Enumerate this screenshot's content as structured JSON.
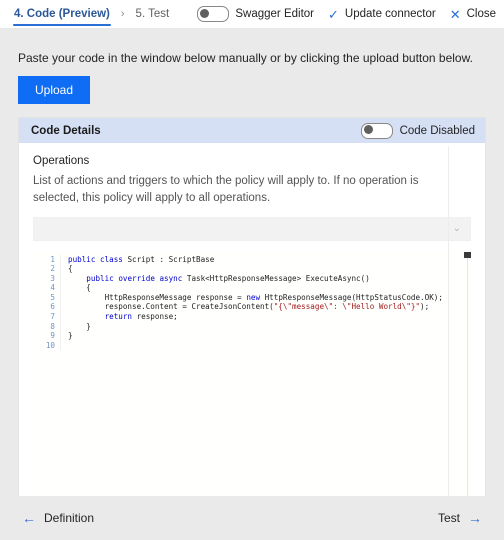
{
  "topbar": {
    "breadcrumbs": [
      {
        "label": "4. Code (Preview)",
        "active": true
      },
      {
        "label": "5. Test",
        "active": false
      }
    ],
    "separator": "›",
    "swagger_toggle_label": "Swagger Editor",
    "swagger_toggle_state": "off",
    "update_connector_label": "Update connector",
    "check_icon": "✓",
    "close_label": "Close",
    "close_icon": "✕"
  },
  "main": {
    "intro_text": "Paste your code in the window below manually or by clicking the upload button below.",
    "upload_label": "Upload"
  },
  "card": {
    "title": "Code Details",
    "code_toggle_label": "Code Disabled",
    "code_toggle_state": "off",
    "operations_label": "Operations",
    "operations_description": "List of actions and triggers to which the policy will apply to. If no operation is selected, this policy will apply to all operations.",
    "operations_value": "",
    "chevron_icon": "⌄"
  },
  "editor": {
    "line_numbers": [
      "1",
      "2",
      "3",
      "4",
      "5",
      "6",
      "7",
      "8",
      "9",
      "10"
    ],
    "lines": [
      "public class Script : ScriptBase",
      "{",
      "    public override async Task<HttpResponseMessage> ExecuteAsync()",
      "    {",
      "        HttpResponseMessage response = new HttpResponseMessage(HttpStatusCode.OK);",
      "        response.Content = CreateJsonContent(\"{\\\"message\\\": \\\"Hello World\\\"}\");",
      "        return response;",
      "    }",
      "}",
      ""
    ],
    "language": "csharp"
  },
  "footer": {
    "back_label": "Definition",
    "back_icon": "←",
    "next_label": "Test",
    "next_icon": "→"
  },
  "colors": {
    "accent": "#0f6cf5",
    "link": "#2b6fd6",
    "card_header": "#d6e0f5",
    "page_bg": "#eaeaea",
    "keyword": "#0000d0",
    "string": "#a21d1d"
  }
}
